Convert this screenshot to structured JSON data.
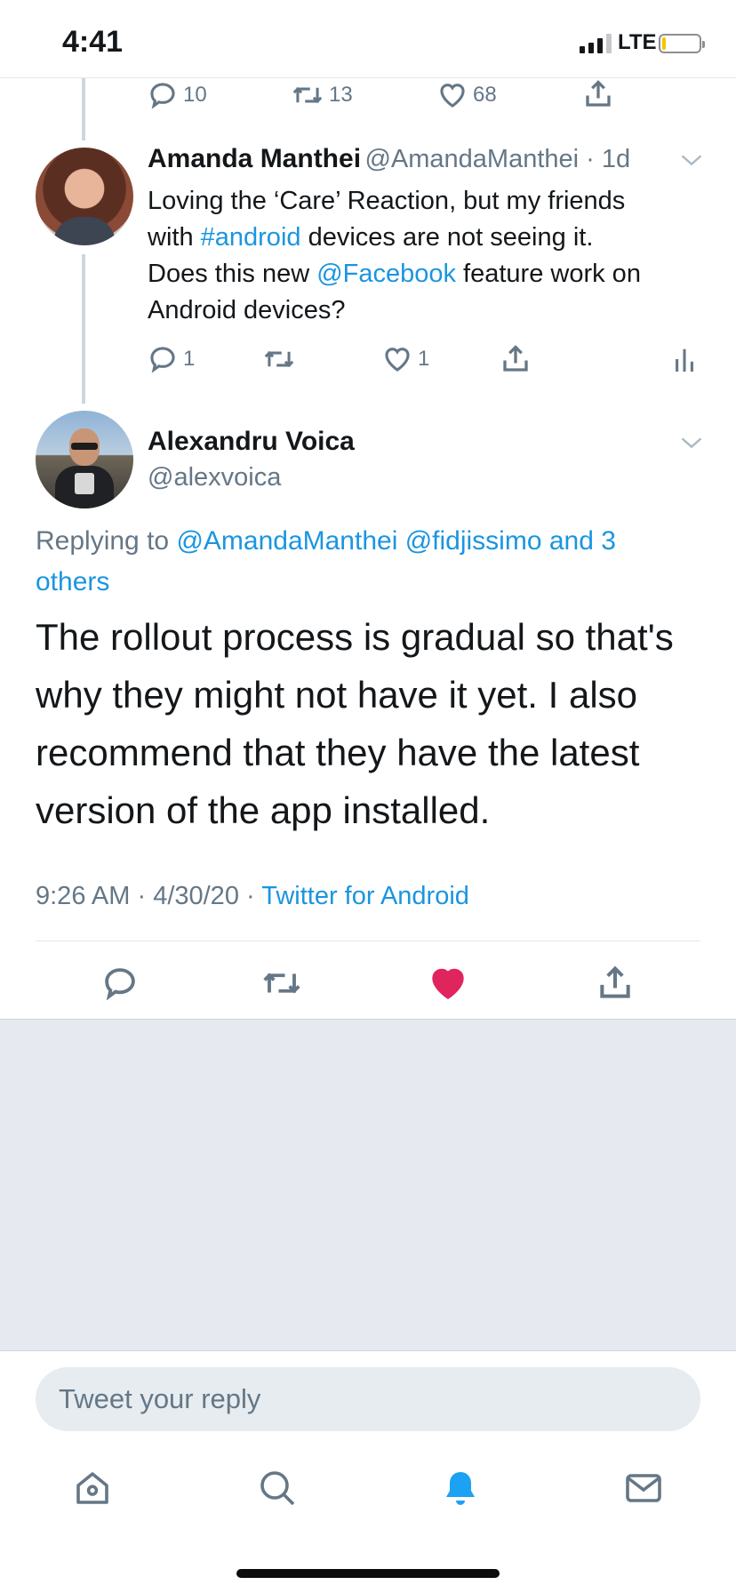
{
  "status_bar": {
    "time": "4:41",
    "network": "LTE"
  },
  "prev_tweet_actions": {
    "reply_count": "10",
    "retweet_count": "13",
    "like_count": "68"
  },
  "parent_tweet": {
    "author_name": "Amanda Manthei",
    "author_handle": "@AmandaManthei",
    "age": "1d",
    "text_1": "Loving the ‘Care’ Reaction, but my friends",
    "text_2a": "with ",
    "hashtag": "#android",
    "text_2b": " devices are not seeing it.",
    "text_3a": "Does this new ",
    "mention": "@Facebook",
    "text_3b": " feature work on",
    "text_4": "Android devices?",
    "reply_count": "1",
    "retweet_count": "",
    "like_count": "1"
  },
  "main_tweet": {
    "author_name": "Alexandru Voica",
    "author_handle": "@alexvoica",
    "replying_label": "Replying to ",
    "replying_targets": "@AmandaManthei @fidjissimo and 3",
    "replying_targets_2": "others",
    "text": "The rollout process is gradual so that's why they might not have it yet. I also recommend that they have the latest version of the app installed.",
    "time": "9:26 AM",
    "date": "4/30/20",
    "source": "Twitter for Android",
    "liked": true
  },
  "reply_box": {
    "placeholder": "Tweet your reply"
  },
  "colors": {
    "accent": "#1da1f2",
    "link": "#1b95e0",
    "like": "#e0245e",
    "muted": "#657786"
  },
  "tab_bar": [
    "home-icon",
    "search-icon",
    "notifications-icon",
    "messages-icon"
  ]
}
